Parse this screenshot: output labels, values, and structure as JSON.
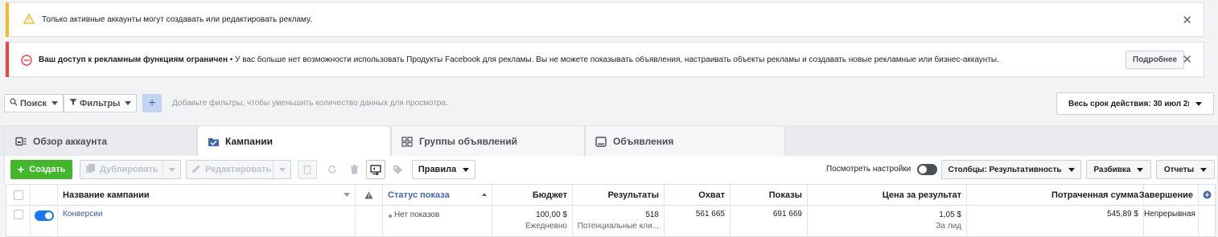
{
  "alerts": {
    "warning": {
      "text": "Только активные аккаунты могут создавать или редактировать рекламу."
    },
    "error": {
      "bold": "Ваш доступ к рекламным функциям ограничен",
      "text": " • У вас больше нет возможности использовать Продукты Facebook для рекламы. Вы не можете показывать объявления, настраивать объекты рекламы и создавать новые рекламные или бизнес-аккаунты.",
      "more_button": "Подробнее"
    }
  },
  "filterbar": {
    "search": "Поиск",
    "filters": "Фильтры",
    "placeholder": "Добавьте фильтры, чтобы уменьшить количество данных для просмотра.",
    "date_range": "Весь срок действия: 30 июл 2("
  },
  "tabs": [
    "Обзор аккаунта",
    "Кампании",
    "Группы объявлений",
    "Объявления"
  ],
  "toolbar": {
    "create": "Создать",
    "duplicate": "Дублировать",
    "edit": "Редактировать",
    "rules": "Правила",
    "view_settings": "Посмотреть настройки",
    "columns": "Столбцы: Результативность",
    "breakdown": "Разбивка",
    "reports": "Отчеты"
  },
  "table": {
    "headers": {
      "name": "Название кампании",
      "status": "Статус показа",
      "budget": "Бюджет",
      "results": "Результаты",
      "reach": "Охват",
      "impressions": "Показы",
      "cost_per_result": "Цена за результат",
      "spent": "Потраченная сумма",
      "ends": "Завершение"
    },
    "row": {
      "name": "Конверсии",
      "status": "Нет показов",
      "budget": "100,00 $",
      "budget_sub": "Ежедневно",
      "results": "518",
      "results_sub": "Потенциальные кли...",
      "reach": "561 665",
      "impressions": "691 669",
      "cost_per_result": "1,05 $",
      "cost_sub": "За лид",
      "spent": "545,89 $",
      "ends": "Непрерывная"
    }
  },
  "colors": {
    "warning": "#f7b928",
    "error": "#fa3e3e",
    "create_green": "#42b72a",
    "link_blue": "#385898",
    "toggle_blue": "#1877f2"
  }
}
